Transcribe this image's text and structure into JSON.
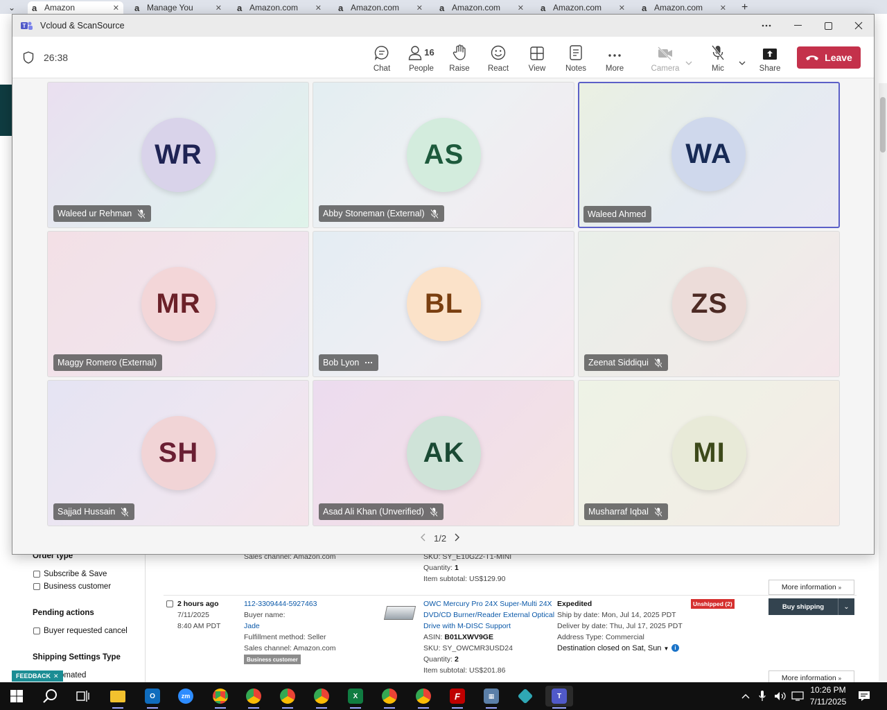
{
  "browser": {
    "tabs": [
      {
        "label": "Amazon",
        "icon": "amazon-icon"
      },
      {
        "label": "Manage You",
        "icon": "amazon-icon"
      },
      {
        "label": "Amazon.com",
        "icon": "amazon-icon"
      },
      {
        "label": "Amazon.com",
        "icon": "amazon-icon"
      },
      {
        "label": "Amazon.com",
        "icon": "amazon-icon"
      },
      {
        "label": "Amazon.com",
        "icon": "amazon-icon"
      },
      {
        "label": "Amazon.com",
        "icon": "amazon-icon"
      }
    ],
    "new_tab": "+"
  },
  "seller": {
    "filters": {
      "order_type_heading": "Order type",
      "subscribe_save": "Subscribe & Save",
      "business_customer": "Business customer",
      "pending_heading": "Pending actions",
      "buyer_cancel": "Buyer requested cancel",
      "shipping_heading": "Shipping Settings Type",
      "automated_partial": "omated"
    },
    "feedback_label": "FEEDBACK",
    "prev_row": {
      "sales_channel": "Sales channel: Amazon.com",
      "sku": "SKU: SY_E10G22-T1-MINI",
      "quantity": "Quantity:",
      "quantity_value": "1",
      "subtotal": "Item subtotal: US$129.90",
      "more_info": "More information"
    },
    "order": {
      "age": "2 hours ago",
      "date": "7/11/2025",
      "time": "8:40 AM PDT",
      "order_id": "112-3309444-5927463",
      "buyer_label": "Buyer name:",
      "buyer_name": "Jade",
      "fulfillment": "Fulfillment method: Seller",
      "sales_channel": "Sales channel: Amazon.com",
      "business_badge": "Business customer",
      "product_line1": "OWC Mercury Pro 24X Super-Multi 24X",
      "product_line2": "DVD/CD Burner/Reader External Optical",
      "product_line3": "Drive with M-DISC Support",
      "asin_label": "ASIN:",
      "asin": "B01LXWV9GE",
      "sku": "SKU: SY_OWCMR3USD24",
      "quantity": "Quantity:",
      "quantity_value": "2",
      "subtotal": "Item subtotal: US$201.86",
      "service": "Expedited",
      "ship_by": "Ship by date: Mon, Jul 14, 2025 PDT",
      "deliver_by": "Deliver by date: Thu, Jul 17, 2025 PDT",
      "address_type": "Address Type:  Commercial",
      "destination": "Destination closed on Sat, Sun",
      "status": "Unshipped (2)",
      "buy_shipping": "Buy shipping",
      "more_info": "More information"
    }
  },
  "teams": {
    "window_title": "Vcloud & ScanSource",
    "timer": "26:38",
    "toolbar": {
      "chat": "Chat",
      "people": "People",
      "people_count": "16",
      "raise": "Raise",
      "react": "React",
      "view": "View",
      "notes": "Notes",
      "more": "More",
      "camera": "Camera",
      "mic": "Mic",
      "share": "Share",
      "leave": "Leave"
    },
    "participants": [
      {
        "initials": "WR",
        "name": "Waleed ur Rehman",
        "muted": true,
        "speaking": false,
        "avatar_bg": "#d9d3ea",
        "avatar_fg": "#1f2354"
      },
      {
        "initials": "AS",
        "name": "Abby Stoneman (External)",
        "muted": true,
        "speaking": false,
        "avatar_bg": "#d3ecdd",
        "avatar_fg": "#1d5a3c"
      },
      {
        "initials": "WA",
        "name": "Waleed Ahmed",
        "muted": false,
        "speaking": true,
        "avatar_bg": "#cfd8ec",
        "avatar_fg": "#172a55"
      },
      {
        "initials": "MR",
        "name": "Maggy Romero (External)",
        "muted": false,
        "speaking": false,
        "avatar_bg": "#f3d6d8",
        "avatar_fg": "#6b2129"
      },
      {
        "initials": "BL",
        "name": "Bob Lyon",
        "muted": false,
        "speaking": false,
        "more": true,
        "avatar_bg": "#fbe2c9",
        "avatar_fg": "#7a3f10"
      },
      {
        "initials": "ZS",
        "name": "Zeenat Siddiqui",
        "muted": true,
        "speaking": false,
        "avatar_bg": "#ecdcd9",
        "avatar_fg": "#4d2a24"
      },
      {
        "initials": "SH",
        "name": "Sajjad Hussain",
        "muted": true,
        "speaking": false,
        "avatar_bg": "#f1d4d6",
        "avatar_fg": "#6a1f33"
      },
      {
        "initials": "AK",
        "name": "Asad Ali Khan (Unverified)",
        "muted": true,
        "speaking": false,
        "avatar_bg": "#cfe3d8",
        "avatar_fg": "#1a4a34"
      },
      {
        "initials": "MI",
        "name": "Musharraf Iqbal",
        "muted": true,
        "speaking": false,
        "avatar_bg": "#e8ead8",
        "avatar_fg": "#3d4a1a"
      }
    ],
    "pagination": "1/2",
    "colors": {
      "leave": "#c4314b",
      "speaking_border": "#5b5fc7"
    }
  },
  "taskbar": {
    "time": "10:26 PM",
    "date": "7/11/2025",
    "apps": [
      "windows-start",
      "search",
      "task-view",
      "file-explorer",
      "outlook",
      "zoom",
      "chrome-w",
      "chrome-profile-1",
      "chrome-profile-2",
      "chrome-profile-3",
      "excel",
      "chrome-profile-4",
      "chrome-profile-5",
      "filezilla",
      "calculator",
      "app-diamond",
      "teams"
    ]
  }
}
